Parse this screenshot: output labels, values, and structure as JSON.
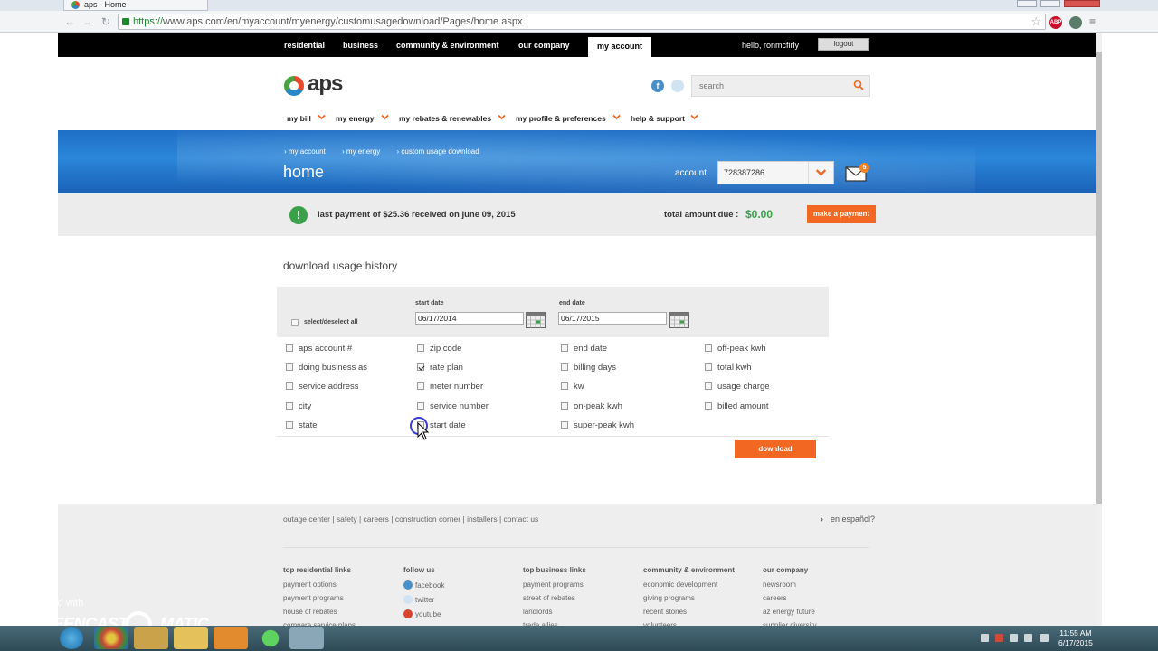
{
  "browser": {
    "tab_title": "aps - Home",
    "url_scheme": "https://",
    "url_rest": "www.aps.com/en/myaccount/myenergy/customusagedownload/Pages/home.aspx",
    "ext_badge": "ABP"
  },
  "topnav": {
    "items": [
      "residential",
      "business",
      "community & environment",
      "our company",
      "my account"
    ],
    "greeting": "hello, ronmcfirly",
    "logout": "logout"
  },
  "header": {
    "logo": "aps",
    "search_placeholder": "search",
    "mainnav": [
      "my bill",
      "my energy",
      "my rebates & renewables",
      "my profile & preferences",
      "help & support"
    ]
  },
  "banner": {
    "breadcrumb": [
      "my account",
      "my energy",
      "custom usage download"
    ],
    "title": "home",
    "account_label": "account",
    "account_number": "728387286",
    "mail_count": "5"
  },
  "payment": {
    "message": "last payment of $25.36 received on june 09, 2015",
    "due_label": "total amount due :",
    "due_amount": "$0.00",
    "button": "make a payment"
  },
  "download": {
    "title": "download usage history",
    "select_all": "select/deselect all",
    "start_label": "start date",
    "start_value": "06/17/2014",
    "end_label": "end date",
    "end_value": "06/17/2015",
    "columns": [
      [
        {
          "label": "aps account #",
          "checked": false
        },
        {
          "label": "doing business as",
          "checked": false
        },
        {
          "label": "service address",
          "checked": false
        },
        {
          "label": "city",
          "checked": false
        },
        {
          "label": "state",
          "checked": false
        }
      ],
      [
        {
          "label": "zip code",
          "checked": false
        },
        {
          "label": "rate plan",
          "checked": true
        },
        {
          "label": "meter number",
          "checked": false
        },
        {
          "label": "service number",
          "checked": false
        },
        {
          "label": "start date",
          "checked": false
        }
      ],
      [
        {
          "label": "end date",
          "checked": false
        },
        {
          "label": "billing days",
          "checked": false
        },
        {
          "label": "kw",
          "checked": false
        },
        {
          "label": "on-peak kwh",
          "checked": false
        },
        {
          "label": "super-peak kwh",
          "checked": false
        }
      ],
      [
        {
          "label": "off-peak kwh",
          "checked": false
        },
        {
          "label": "total kwh",
          "checked": false
        },
        {
          "label": "usage charge",
          "checked": false
        },
        {
          "label": "billed amount",
          "checked": false
        }
      ]
    ],
    "button": "download"
  },
  "footer": {
    "links": [
      "outage center",
      "safety",
      "careers",
      "construction corner",
      "installers",
      "contact us"
    ],
    "espanol": "en español?",
    "columns": [
      {
        "heading": "top residential links",
        "items": [
          "payment options",
          "payment programs",
          "house of rebates",
          "compare service plans"
        ]
      },
      {
        "heading": "follow us",
        "items": [
          "facebook",
          "twitter",
          "youtube"
        ]
      },
      {
        "heading": "top business links",
        "items": [
          "payment programs",
          "street of rebates",
          "landlords",
          "trade allies"
        ]
      },
      {
        "heading": "community & environment",
        "items": [
          "economic development",
          "giving programs",
          "recent stories",
          "volunteers"
        ]
      },
      {
        "heading": "our company",
        "items": [
          "newsroom",
          "careers",
          "az energy future",
          "supplier diversity"
        ]
      }
    ]
  },
  "watermark": {
    "line1": "Recorded with",
    "line2": "SCREENCAST",
    "line3": "MATIC"
  },
  "taskbar": {
    "time": "11:55 AM",
    "date": "6/17/2015"
  },
  "colors": {
    "brand_orange": "#f26722",
    "success_green": "#3aa04a",
    "banner_blue": "#2b86d9"
  }
}
